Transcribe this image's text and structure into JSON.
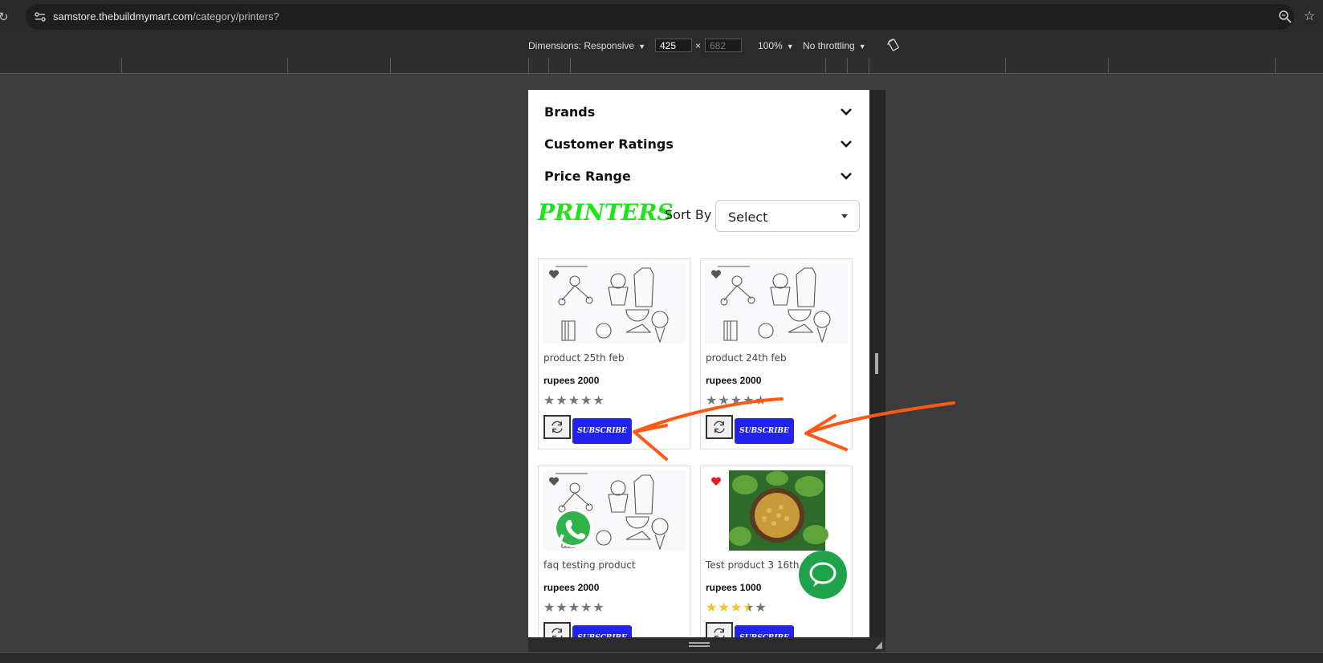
{
  "browser": {
    "url_host": "samstore.thebuildmymart.com",
    "url_path": "/category/printers?"
  },
  "devtools": {
    "dimensions_label": "Dimensions: Responsive",
    "width": "425",
    "height": "682",
    "zoom": "100%",
    "throttling": "No throttling"
  },
  "filters": [
    {
      "label": "Brands"
    },
    {
      "label": "Customer Ratings"
    },
    {
      "label": "Price Range"
    }
  ],
  "category": {
    "title": "PRINTERS",
    "sort_label": "Sort By",
    "sort_value": "Select"
  },
  "products": [
    {
      "name": "product 25th feb",
      "price": "rupees 2000",
      "rating": 0,
      "wishlisted": false,
      "subscribe": "SUBSCRIBE"
    },
    {
      "name": "product 24th feb",
      "price": "rupees 2000",
      "rating": 0,
      "wishlisted": false,
      "subscribe": "SUBSCRIBE"
    },
    {
      "name": "faq testing product",
      "price": "rupees 2000",
      "rating": 0,
      "wishlisted": false,
      "subscribe": "SUBSCRIBE"
    },
    {
      "name": "Test product 3 16th",
      "price": "rupees 1000",
      "rating": 3.5,
      "wishlisted": true,
      "subscribe": "SUBSCRIBE"
    }
  ],
  "colors": {
    "title": "#22e21a",
    "subscribe_bg": "#2222ee",
    "annotation_arrow": "#ff5a14",
    "chat_bubble": "#1ea34b",
    "heart_active": "#e02020"
  }
}
